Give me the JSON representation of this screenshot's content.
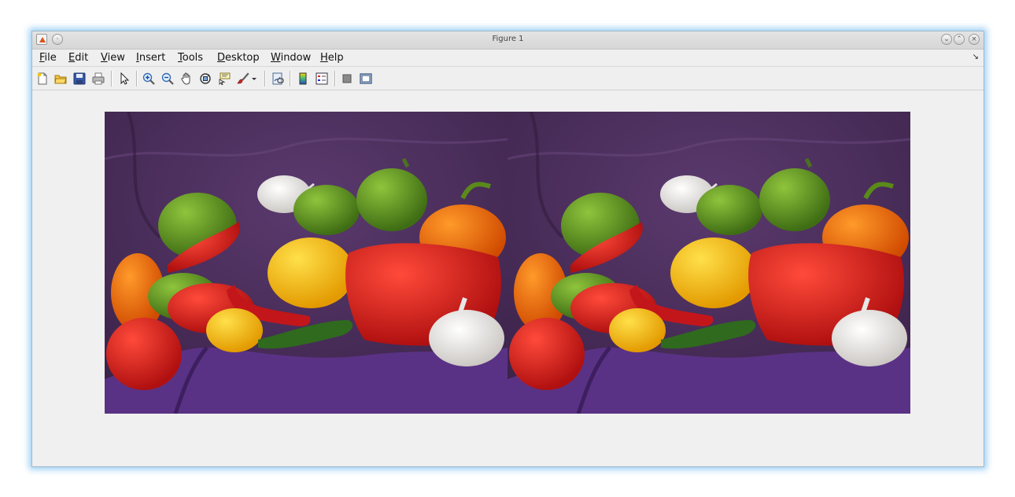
{
  "window": {
    "title": "Figure 1"
  },
  "menubar": {
    "items": [
      {
        "label": "File",
        "mnemonic": "F",
        "rest": "ile"
      },
      {
        "label": "Edit",
        "mnemonic": "E",
        "rest": "dit"
      },
      {
        "label": "View",
        "mnemonic": "V",
        "rest": "iew"
      },
      {
        "label": "Insert",
        "mnemonic": "I",
        "rest": "nsert"
      },
      {
        "label": "Tools",
        "mnemonic": "T",
        "rest": "ools"
      },
      {
        "label": "Desktop",
        "mnemonic": "D",
        "rest": "esktop"
      },
      {
        "label": "Window",
        "mnemonic": "W",
        "rest": "indow"
      },
      {
        "label": "Help",
        "mnemonic": "H",
        "rest": "elp"
      }
    ]
  },
  "toolbar": {
    "icons": [
      "new-figure-icon",
      "open-file-icon",
      "save-icon",
      "print-icon",
      "edit-plot-arrow-icon",
      "zoom-in-icon",
      "zoom-out-icon",
      "pan-hand-icon",
      "rotate-3d-icon",
      "data-cursor-icon",
      "brush-icon",
      "link-plot-icon",
      "insert-colorbar-icon",
      "insert-legend-icon",
      "hide-plot-tools-icon",
      "show-plot-tools-icon"
    ]
  },
  "axes": {
    "content": "side-by-side peppers image",
    "background_color": "#4a2c5a"
  }
}
